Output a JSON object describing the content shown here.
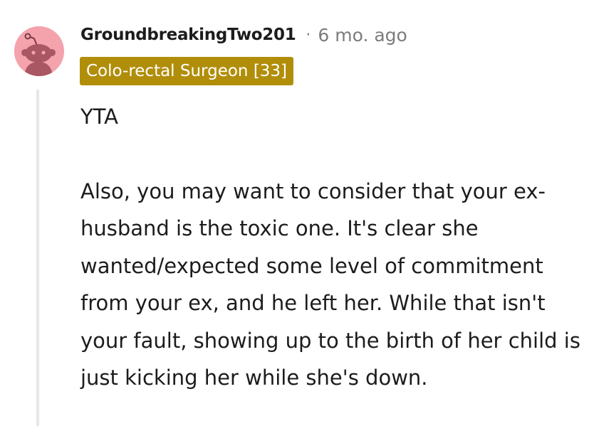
{
  "comment": {
    "username": "GroundbreakingTwo201",
    "separator": "·",
    "timestamp": "6 mo. ago",
    "flair": "Colo-rectal Surgeon [33]",
    "avatar_icon": "snoo-avatar-icon",
    "body": {
      "verdict": "YTA",
      "paragraph": "Also, you may want to consider that your ex-husband is the toxic one. It's clear she wanted/expected some level of commitment from your ex, and he left her. While that isn't your fault, showing up to the birth of her child is just kicking her while she's down."
    }
  },
  "colors": {
    "flair_background": "#b18e0a",
    "avatar_background": "#f4a3ad",
    "meta_text": "#7c7c7c"
  }
}
